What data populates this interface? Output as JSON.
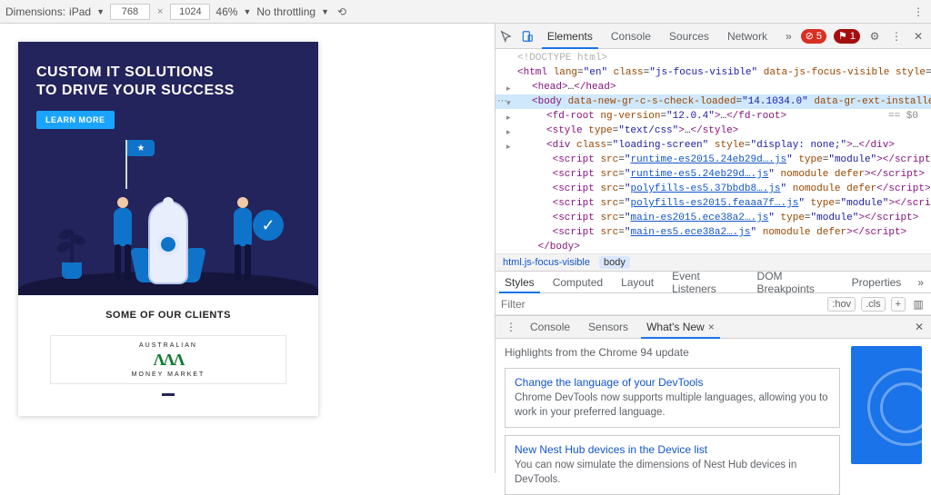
{
  "toolbar": {
    "dimensions_label": "Dimensions:",
    "device": "iPad",
    "width": "768",
    "height": "1024",
    "zoom": "46%",
    "throttling": "No throttling"
  },
  "preview": {
    "hero_line1": "CUSTOM IT SOLUTIONS",
    "hero_line2": "TO DRIVE YOUR SUCCESS",
    "learn_more": "LEARN MORE",
    "flag_star": "★",
    "shield_check": "✓",
    "clients_heading": "SOME OF OUR CLIENTS",
    "client_top": "AUSTRALIAN",
    "client_mark": "ΛΛΛ",
    "client_bottom": "MONEY MARKET"
  },
  "devtools": {
    "tabs": {
      "elements": "Elements",
      "console": "Console",
      "sources": "Sources",
      "network": "Network"
    },
    "more": "»",
    "error_count": "5",
    "issue_count": "1",
    "code": {
      "doctype": "<!DOCTYPE html>",
      "html_open": "<html lang=\"en\" class=\"js-focus-visible\" data-js-focus-visible style=\"scroll-behavior: smooth;\">",
      "head": "<head>…</head>",
      "body_open_pre": "<body ",
      "body_attr1_name": "data-new-gr-c-s-check-loaded",
      "body_attr1_val": "\"14.1034.0\"",
      "body_attr2_name": "data-gr-ext-installed",
      "body_close": ">",
      "eq0": "== $0",
      "fdroot": "<fd-root ng-version=\"12.0.4\">…</fd-root>",
      "style": "<style type=\"text/css\">…</style>",
      "loading": "<div class=\"loading-screen\" style=\"display: none;\">…</div>",
      "s1a": "<script src=\"",
      "s1b": "runtime-es2015.24eb29d….js",
      "s1c": "\" type=\"module\"></scr",
      "s1d": "ipt>",
      "s2a": "<script src=\"",
      "s2b": "runtime-es5.24eb29d….js",
      "s2c": "\" nomodule defer></scr",
      "s2d": "ipt>",
      "s3a": "<script src=\"",
      "s3b": "polyfills-es5.37bbdb8….js",
      "s3c": "\" nomodule defer></scr",
      "s3d": "ipt>",
      "s4a": "<script src=\"",
      "s4b": "polyfills-es2015.feaaa7f….js",
      "s4c": "\" type=\"module\"></scr",
      "s4d": "ipt>",
      "s5a": "<script src=\"",
      "s5b": "main-es2015.ece38a2….js",
      "s5c": "\" type=\"module\"></scr",
      "s5d": "ipt>",
      "s6a": "<script src=\"",
      "s6b": "main-es5.ece38a2….js",
      "s6c": "\" nomodule defer></scr",
      "s6d": "ipt>",
      "body_end": "</body>"
    },
    "crumbs": {
      "c1": "html.js-focus-visible",
      "c2": "body"
    },
    "styles_tabs": {
      "styles": "Styles",
      "computed": "Computed",
      "layout": "Layout",
      "event": "Event Listeners",
      "dom": "DOM Breakpoints",
      "props": "Properties"
    },
    "filter_placeholder": "Filter",
    "hov": ":hov",
    "cls": ".cls",
    "plus": "+",
    "drawer": {
      "console": "Console",
      "sensors": "Sensors",
      "whatsnew": "What's New",
      "highlights": "Highlights from the Chrome 94 update",
      "card1_title": "Change the language of your DevTools",
      "card1_desc": "Chrome DevTools now supports multiple languages, allowing you to work in your preferred language.",
      "card2_title": "New Nest Hub devices in the Device list",
      "card2_desc": "You can now simulate the dimensions of Nest Hub devices in DevTools."
    }
  }
}
